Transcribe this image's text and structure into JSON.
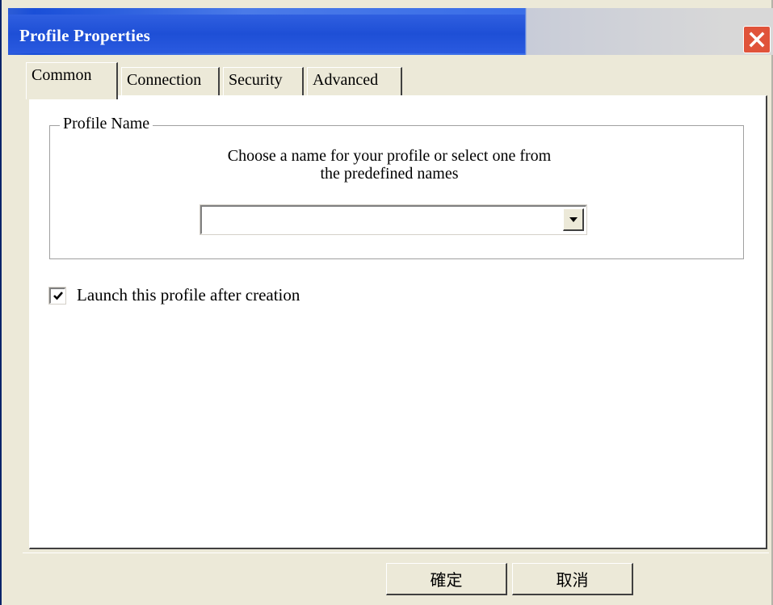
{
  "window": {
    "title": "Profile Properties",
    "close_icon": "close-icon"
  },
  "tabs": [
    {
      "label": "Common",
      "active": true
    },
    {
      "label": "Connection",
      "active": false
    },
    {
      "label": "Security",
      "active": false
    },
    {
      "label": "Advanced",
      "active": false
    }
  ],
  "common": {
    "group_label": "Profile Name",
    "instruction_line1": "Choose a name for your profile or select one from",
    "instruction_line2": "the predefined names",
    "profile_name_value": "",
    "launch_checkbox_label": "Launch this profile after creation",
    "launch_checked": true
  },
  "buttons": {
    "ok_label": "確定",
    "cancel_label": "取消"
  },
  "colors": {
    "titlebar": "#2a5ad6",
    "close": "#e0533a",
    "dialog_bg": "#ece9d8"
  }
}
